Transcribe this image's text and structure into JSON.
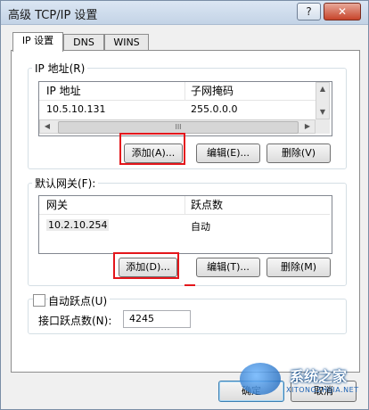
{
  "window": {
    "title": "高级 TCP/IP 设置",
    "help_glyph": "?",
    "close_glyph": "✕"
  },
  "tabs": [
    {
      "label": "IP 设置"
    },
    {
      "label": "DNS"
    },
    {
      "label": "WINS"
    }
  ],
  "ip_group": {
    "legend": "IP 地址(R)",
    "columns": [
      "IP 地址",
      "子网掩码"
    ],
    "rows": [
      {
        "ip": "10.5.10.131",
        "mask": "255.0.0.0"
      }
    ],
    "scroll_grip": "III",
    "add": "添加(A)...",
    "edit": "编辑(E)...",
    "delete": "删除(V)"
  },
  "gateway_group": {
    "legend": "默认网关(F):",
    "columns": [
      "网关",
      "跃点数"
    ],
    "rows": [
      {
        "gateway": "10.2.10.254",
        "metric": "自动"
      }
    ],
    "add": "添加(D)...",
    "edit": "编辑(T)...",
    "delete": "删除(M)"
  },
  "auto_metric": {
    "label": "自动跃点(U)",
    "checked": false
  },
  "interface_metric": {
    "label": "接口跃点数(N):",
    "value": "4245"
  },
  "footer": {
    "ok": "确定",
    "cancel": "取消"
  },
  "watermark": {
    "text": "系统之家",
    "sub": "XITONGZHIJIA.NET"
  },
  "accent": {
    "highlight_box": "#e4161b"
  }
}
